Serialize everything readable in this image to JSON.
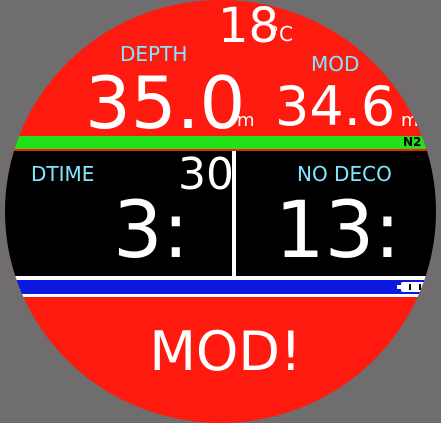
{
  "temperature": {
    "value": "18",
    "unit": "°C"
  },
  "depth": {
    "label": "DEPTH",
    "value": "35.0",
    "unit": "m"
  },
  "mod": {
    "label": "MOD",
    "value": "34.6",
    "unit": "m"
  },
  "gas": {
    "label": "N2"
  },
  "dive_time": {
    "label": "DTIME",
    "minutes": "3:",
    "seconds": "30"
  },
  "no_deco": {
    "label": "NO DECO",
    "value": "13:"
  },
  "warning": {
    "text": "MOD!"
  },
  "colors": {
    "background": "#6f6d6d",
    "dial": "#ff1a10",
    "label": "#7fe8ff",
    "gas_bar": "#22e01a",
    "status_bar": "#0a18e0"
  },
  "icons": {
    "battery": "battery-icon"
  }
}
